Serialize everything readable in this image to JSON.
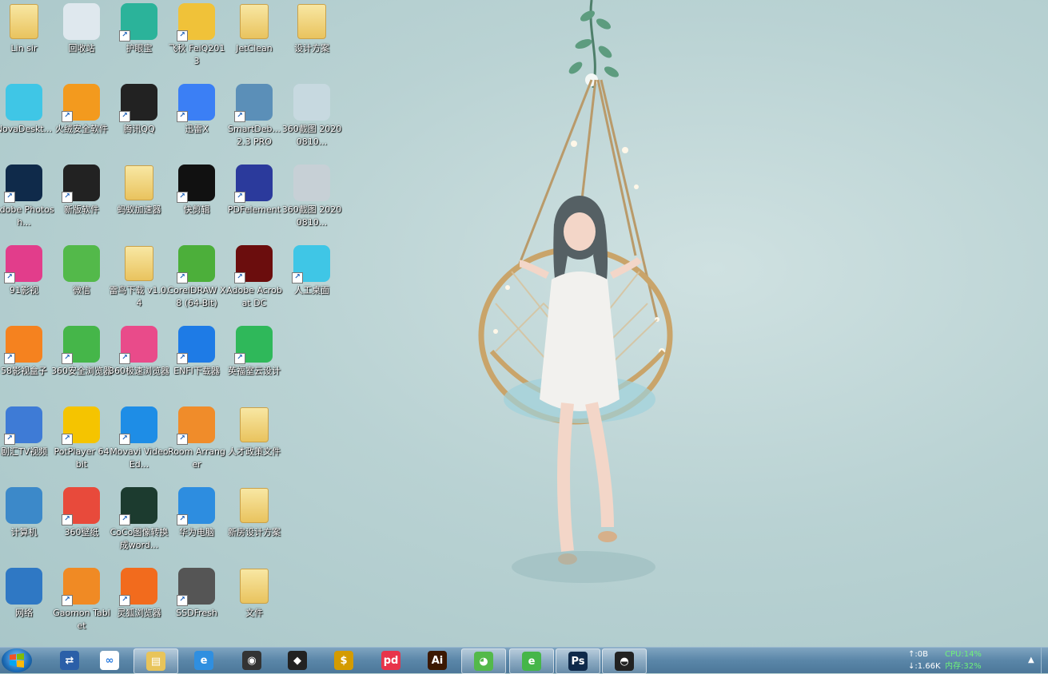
{
  "colors": {
    "wallpaper": "#b9d2d3",
    "taskbar": "#5a86a8",
    "monitor_text": "#6ff27a"
  },
  "desktop_icons": [
    {
      "label": "Lin sir",
      "icon": "user-folder-icon",
      "col": 0,
      "row": 0,
      "shortcut": false,
      "color": "#e8c45a"
    },
    {
      "label": "回收站",
      "icon": "recycle-bin-icon",
      "col": 1,
      "row": 0,
      "shortcut": false,
      "color": "#dfe8ee"
    },
    {
      "label": "护眼宝",
      "icon": "eye-care-icon",
      "col": 2,
      "row": 0,
      "shortcut": true,
      "color": "#2bb39a"
    },
    {
      "label": "飞秋 FeiQ2013",
      "icon": "feiq-icon",
      "col": 3,
      "row": 0,
      "shortcut": true,
      "color": "#f0c239"
    },
    {
      "label": "JetClean",
      "icon": "folder-icon",
      "col": 4,
      "row": 0,
      "shortcut": false,
      "color": "#e8c45a"
    },
    {
      "label": "设计方案",
      "icon": "folder-icon",
      "col": 5,
      "row": 0,
      "shortcut": false,
      "color": "#e8c45a"
    },
    {
      "label": "NovaDeskt...",
      "icon": "nova-desktop-icon",
      "col": 0,
      "row": 1,
      "shortcut": false,
      "color": "#3fc6e6"
    },
    {
      "label": "火绒安全软件",
      "icon": "huorong-icon",
      "col": 1,
      "row": 1,
      "shortcut": true,
      "color": "#f39a1e"
    },
    {
      "label": "腾讯QQ",
      "icon": "qq-penguin-icon",
      "col": 2,
      "row": 1,
      "shortcut": true,
      "color": "#222222"
    },
    {
      "label": "迅雷X",
      "icon": "xunlei-icon",
      "col": 3,
      "row": 1,
      "shortcut": true,
      "color": "#3b7ff5"
    },
    {
      "label": "SmartDeb... 2.3 PRO",
      "icon": "magnifier-icon",
      "col": 4,
      "row": 1,
      "shortcut": true,
      "color": "#5b8fb8"
    },
    {
      "label": "360截图 20200810...",
      "icon": "screenshot-thumb-icon",
      "col": 5,
      "row": 1,
      "shortcut": false,
      "color": "#c7d9e0"
    },
    {
      "label": "Adobe Photosh...",
      "icon": "photoshop-icon",
      "col": 0,
      "row": 2,
      "shortcut": true,
      "color": "#0f2a4a"
    },
    {
      "label": "新版软件",
      "icon": "dollar-icon",
      "col": 1,
      "row": 2,
      "shortcut": true,
      "color": "#222222"
    },
    {
      "label": "蚂蚁加速器",
      "icon": "folder-zip-icon",
      "col": 2,
      "row": 2,
      "shortcut": false,
      "color": "#e8c45a"
    },
    {
      "label": "快剪辑",
      "icon": "kuaijianji-icon",
      "col": 3,
      "row": 2,
      "shortcut": true,
      "color": "#111111"
    },
    {
      "label": "PDFelement",
      "icon": "pdfelement-icon",
      "col": 4,
      "row": 2,
      "shortcut": true,
      "color": "#2b3a9c"
    },
    {
      "label": "360截图 20200810...",
      "icon": "screenshot-thumb-icon",
      "col": 5,
      "row": 2,
      "shortcut": false,
      "color": "#c7d0d6"
    },
    {
      "label": "91影视",
      "icon": "video-91-icon",
      "col": 0,
      "row": 3,
      "shortcut": true,
      "color": "#e23d8b"
    },
    {
      "label": "微信",
      "icon": "wechat-icon",
      "col": 1,
      "row": 3,
      "shortcut": false,
      "color": "#53b94a"
    },
    {
      "label": "雷鸟下载 v1.0.4",
      "icon": "folder-icon",
      "col": 2,
      "row": 3,
      "shortcut": false,
      "color": "#e8c45a"
    },
    {
      "label": "CorelDRAW X8 (64-Bit)",
      "icon": "coreldraw-icon",
      "col": 3,
      "row": 3,
      "shortcut": true,
      "color": "#4caf3a"
    },
    {
      "label": "Adobe Acrobat DC",
      "icon": "acrobat-icon",
      "col": 4,
      "row": 3,
      "shortcut": true,
      "color": "#6b0d0d"
    },
    {
      "label": "人工桌面",
      "icon": "nova-desktop-icon",
      "col": 5,
      "row": 3,
      "shortcut": true,
      "color": "#3fc6e6"
    },
    {
      "label": "58影视盒子",
      "icon": "tv-box-icon",
      "col": 0,
      "row": 4,
      "shortcut": true,
      "color": "#f5821f"
    },
    {
      "label": "360安全浏览器",
      "icon": "360-browser-icon",
      "col": 1,
      "row": 4,
      "shortcut": true,
      "color": "#45b649"
    },
    {
      "label": "360极速浏览器",
      "icon": "360-speed-browser-icon",
      "col": 2,
      "row": 4,
      "shortcut": true,
      "color": "#e94b8a"
    },
    {
      "label": "ENFI下载器",
      "icon": "enfi-downloader-icon",
      "col": 3,
      "row": 4,
      "shortcut": true,
      "color": "#1e7be6"
    },
    {
      "label": "英福室云设计",
      "icon": "m-design-icon",
      "col": 4,
      "row": 4,
      "shortcut": true,
      "color": "#2fb85a"
    },
    {
      "label": "剧汇TV视频",
      "icon": "film-icon",
      "col": 0,
      "row": 5,
      "shortcut": true,
      "color": "#3e7bd6"
    },
    {
      "label": "PotPlayer 64 bit",
      "icon": "potplayer-icon",
      "col": 1,
      "row": 5,
      "shortcut": true,
      "color": "#f5c400"
    },
    {
      "label": "Movavi Video Ed...",
      "icon": "movavi-icon",
      "col": 2,
      "row": 5,
      "shortcut": true,
      "color": "#1e8de6"
    },
    {
      "label": "Room Arranger",
      "icon": "sofa-icon",
      "col": 3,
      "row": 5,
      "shortcut": true,
      "color": "#f08c2a"
    },
    {
      "label": "人才政策文件",
      "icon": "folder-icon",
      "col": 4,
      "row": 5,
      "shortcut": false,
      "color": "#e8c45a"
    },
    {
      "label": "计算机",
      "icon": "computer-icon",
      "col": 0,
      "row": 6,
      "shortcut": false,
      "color": "#3c89c9"
    },
    {
      "label": "360壁纸",
      "icon": "wallpaper-360-icon",
      "col": 1,
      "row": 6,
      "shortcut": true,
      "color": "#e84a3b"
    },
    {
      "label": "CoCo图像转换成word...",
      "icon": "eye-image-icon",
      "col": 2,
      "row": 6,
      "shortcut": true,
      "color": "#1c3b2f"
    },
    {
      "label": "华为电脑",
      "icon": "cloud-icon",
      "col": 3,
      "row": 6,
      "shortcut": true,
      "color": "#2d8de0"
    },
    {
      "label": "新房设计方案",
      "icon": "folder-doc-icon",
      "col": 4,
      "row": 6,
      "shortcut": false,
      "color": "#e8c45a"
    },
    {
      "label": "网络",
      "icon": "network-globe-icon",
      "col": 0,
      "row": 7,
      "shortcut": false,
      "color": "#2f78c4"
    },
    {
      "label": "Gaomon Tablet",
      "icon": "gaomon-icon",
      "col": 1,
      "row": 7,
      "shortcut": true,
      "color": "#f08a24"
    },
    {
      "label": "灵狐浏览器",
      "icon": "fox-browser-icon",
      "col": 2,
      "row": 7,
      "shortcut": true,
      "color": "#f26b1d"
    },
    {
      "label": "SSDFresh",
      "icon": "ssd-icon",
      "col": 3,
      "row": 7,
      "shortcut": true,
      "color": "#555555"
    },
    {
      "label": "文件",
      "icon": "folder-icon",
      "col": 4,
      "row": 7,
      "shortcut": false,
      "color": "#e8c45a"
    }
  ],
  "taskbar": {
    "start_label": "",
    "pinned": [
      {
        "icon": "windows-start-icon",
        "name": "start"
      },
      {
        "icon": "remote-desktop-icon",
        "glyph": "⇄",
        "color": "#2b5fa8",
        "active": false
      },
      {
        "icon": "baidu-netdisk-icon",
        "glyph": "∞",
        "color": "#ffffff",
        "active": false
      },
      {
        "icon": "file-explorer-icon",
        "glyph": "▤",
        "color": "#e8c45a",
        "active": true
      },
      {
        "icon": "ie-browser-icon",
        "glyph": "e",
        "color": "#2f8fe0",
        "active": false
      },
      {
        "icon": "husky-app-icon",
        "glyph": "◉",
        "color": "#333333",
        "active": false
      },
      {
        "icon": "cat-app-icon",
        "glyph": "◆",
        "color": "#222222",
        "active": false
      },
      {
        "icon": "dollar-app-icon",
        "glyph": "$",
        "color": "#d49b00",
        "active": false
      },
      {
        "icon": "pdf-app-icon",
        "glyph": "pd",
        "color": "#e8344a",
        "active": false
      },
      {
        "icon": "illustrator-icon",
        "glyph": "Ai",
        "color": "#3b1800",
        "active": false
      },
      {
        "icon": "wechat-taskbar-icon",
        "glyph": "◕",
        "color": "#53b94a",
        "active": true
      },
      {
        "icon": "360-browser-taskbar-icon",
        "glyph": "e",
        "color": "#45b649",
        "active": true
      },
      {
        "icon": "photoshop-taskbar-icon",
        "glyph": "Ps",
        "color": "#0f2a4a",
        "active": true
      },
      {
        "icon": "qq-taskbar-icon",
        "glyph": "◓",
        "color": "#222222",
        "active": true
      }
    ],
    "net_monitor": {
      "upload": "↑:0B",
      "download": "↓:1.66K",
      "cpu": "CPU:14%",
      "memory": "内存:32%"
    },
    "tray_arrow": "▲"
  }
}
